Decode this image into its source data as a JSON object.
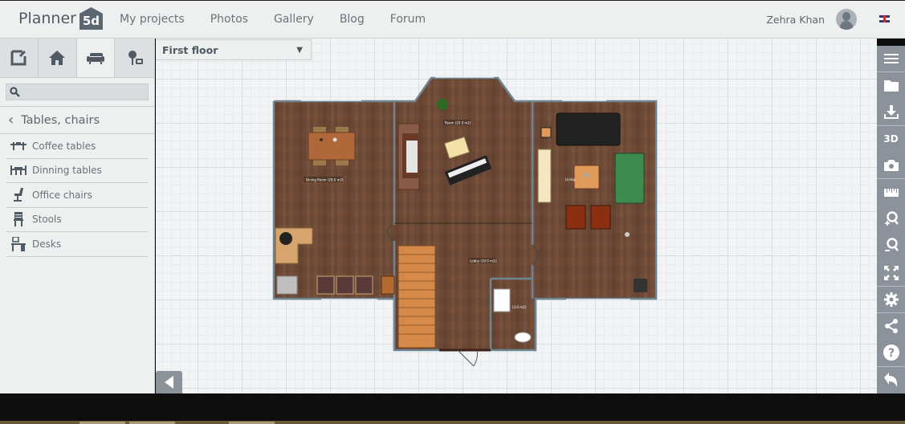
{
  "header": {
    "logo_text": "Planner",
    "logo_badge": "5d",
    "nav": [
      "My projects",
      "Photos",
      "Gallery",
      "Blog",
      "Forum"
    ],
    "user_name": "Zehra Khan",
    "language_flag": "uk-flag-icon"
  },
  "sidebar": {
    "tabs": [
      {
        "name": "edit-icon",
        "active": false
      },
      {
        "name": "home-icon",
        "active": false
      },
      {
        "name": "armchair-icon",
        "active": true
      },
      {
        "name": "tree-outdoor-icon",
        "active": false
      }
    ],
    "search": {
      "value": "",
      "placeholder": ""
    },
    "category_title": "Tables, chairs",
    "items": [
      {
        "label": "Coffee tables",
        "icon": "coffee-table-icon"
      },
      {
        "label": "Dinning tables",
        "icon": "dining-table-icon"
      },
      {
        "label": "Office chairs",
        "icon": "office-chair-icon"
      },
      {
        "label": "Stools",
        "icon": "stool-icon"
      },
      {
        "label": "Desks",
        "icon": "desk-icon"
      }
    ]
  },
  "canvas": {
    "floor_select": {
      "value": "First floor"
    },
    "rooms": [
      {
        "label": "Dining Room (28.0 m2)"
      },
      {
        "label": "Room (20.0 m2)"
      },
      {
        "label": "Living"
      },
      {
        "label": "Lobby (19.0 m2)"
      },
      {
        "label": "(3.0 m2)"
      }
    ]
  },
  "toolbar": [
    {
      "name": "menu-icon"
    },
    {
      "name": "folder-icon"
    },
    {
      "name": "download-icon"
    },
    {
      "name": "3d-view-button",
      "label": "3D"
    },
    {
      "name": "camera-icon"
    },
    {
      "name": "ruler-icon"
    },
    {
      "name": "zoom-in-icon"
    },
    {
      "name": "zoom-out-icon"
    },
    {
      "name": "fit-screen-icon"
    },
    {
      "name": "settings-icon"
    },
    {
      "name": "share-icon"
    },
    {
      "name": "help-icon"
    },
    {
      "name": "undo-icon"
    }
  ],
  "colors": {
    "toolbar": "#8b929a",
    "floor": "#6e4a36",
    "wall": "#6f8591",
    "background": "#eeefef"
  }
}
